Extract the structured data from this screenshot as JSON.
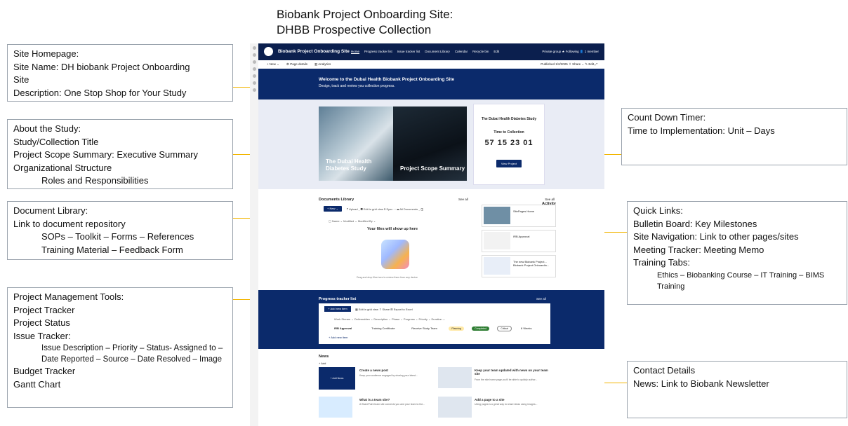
{
  "title_line1": "Biobank Project Onboarding Site:",
  "title_line2": "DHBB Prospective Collection",
  "boxes": {
    "homepage": [
      "Site Homepage:",
      "Site Name: DH biobank Project Onboarding",
      "Site",
      "Description: One Stop Shop for Your Study"
    ],
    "about": [
      "About the Study:",
      "Study/Collection Title",
      "Project Scope Summary: Executive Summary",
      "Organizational Structure",
      "Roles and Responsibilities"
    ],
    "doclib": [
      "Document Library:",
      "Link to document repository",
      "SOPs – Toolkit – Forms – References",
      "Training Material – Feedback Form"
    ],
    "pmtools": [
      "Project Management Tools:",
      "Project Tracker",
      "Project Status",
      "Issue Tracker:",
      "Issue Description – Priority – Status- Assigned to –      Date Reported – Source – Date Resolved – Image",
      "Budget Tracker",
      "Gantt Chart"
    ],
    "countdown": [
      "Count Down Timer:",
      "Time to Implementation: Unit – Days"
    ],
    "quicklinks": [
      "Quick Links:",
      "Bulletin Board: Key Milestones",
      "Site Navigation: Link to other pages/sites",
      "Meeting Tracker: Meeting Memo",
      "Training Tabs:",
      "Ethics – Biobanking Course – IT      Training – BIMS Training"
    ],
    "contact": [
      "Contact Details",
      "News: Link to Biobank Newsletter"
    ]
  },
  "colors": {
    "accent": "#f2b500",
    "navy": "#0b2a6b"
  },
  "mock": {
    "site_name": "Biobank Project Onboarding Site",
    "nav": [
      "Home",
      "Progress tracker list",
      "Issue tracker list",
      "Document Library",
      "Calendar",
      "Recycle bin",
      "Edit"
    ],
    "suite_right": "Private group   ★ Following   👤 1 member",
    "cmd": [
      "+ New ⌄",
      "⚙ Page details",
      "▥ Analytics"
    ],
    "published": "Published 1/2/2025   ⇪ Share ⌄   ✎ Edit   ⤢",
    "welcome_title": "Welcome to the Dubai Health Biobank Project Onboarding Site",
    "welcome_sub": "Design, track and review you collection progress.",
    "tile1": "The Dubai Health Diabetes Study",
    "tile2": "Project Scope Summary",
    "card_title": "The Dubai Health Diabetes Study",
    "card_ttc": "Time to Collection",
    "card_nums": "57  15  23  01",
    "card_btn": "View Project",
    "docs_label": "Documents Library",
    "see_all": "See all",
    "new_btn": "+ New ⌄",
    "docs_tools": "⤒ Upload ⌄   ▦ Edit in grid view   ⇪ Sync   ···        ☰ All Documents ⌄   ⓘ",
    "docs_cols": "▢  Name ⌄                                          Modified ⌄          Modified By ⌄",
    "empty": "Your files will show up here",
    "drag": "Drag and drop files here to review them from any device",
    "activity_label": "Activity",
    "act1": "SitePages Home",
    "act2": "IRB Approval",
    "act3": "The new Biobank Project... Biobank Project Onboardin...",
    "tracker_label": "Progress tracker list",
    "add_item": "+ Add new item",
    "tracker_tools": "▦ Edit in grid view   ⇪ Share   ⊞ Export to Excel",
    "tracker_head": "Work Stream ⌄        Deliverables ⌄        Description ⌄        Phase ⌄        Progress ⌄        Priority ⌄        Duration ⌄",
    "tracker_row_name": "IRB Approval",
    "tracker_row_deliv": "Training Certificate",
    "tracker_row_desc": "Receive Study Team",
    "tracker_row_phase": "Planning",
    "tracker_row_prog": "Completed",
    "tracker_row_pri": "Critical",
    "tracker_row_dur": "8 Weeks",
    "tracker_add": "+ Add new item",
    "news_label": "News",
    "news_add": "+ Add",
    "news_items": [
      {
        "title": "Create a news post",
        "sub": "Keep your audience engaged by sharing your latest..."
      },
      {
        "title": "Keep your team updated with news on your team site",
        "sub": "From the site home page you'll be able to quickly author..."
      },
      {
        "title": "What is a team site?",
        "sub": "A SharePoint team site connects you and your team to the..."
      },
      {
        "title": "Add a page to a site",
        "sub": "Using pages is a great way to share ideas using images..."
      }
    ],
    "add_news": "+ Add News"
  }
}
